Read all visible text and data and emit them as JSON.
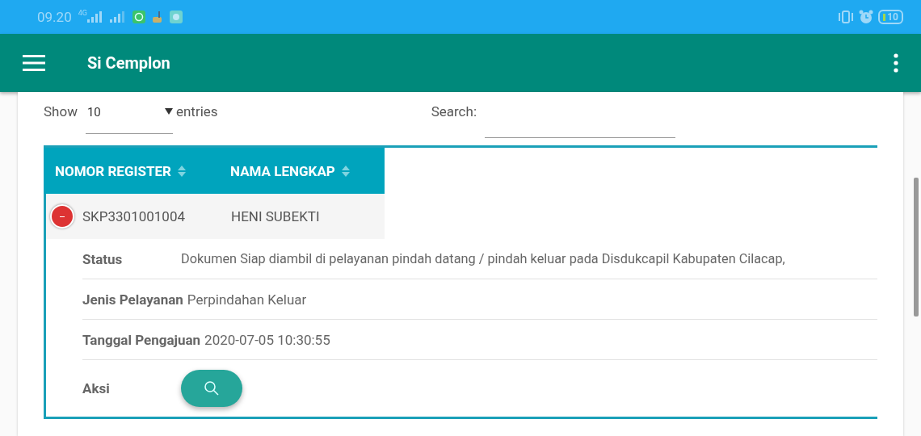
{
  "status_bar": {
    "time": "09.20",
    "network": "4G",
    "battery": "10"
  },
  "app_bar": {
    "title": "Si Cemplon"
  },
  "length_control": {
    "label_before": "Show",
    "value": "10",
    "label_after": "entries"
  },
  "search": {
    "label": "Search:"
  },
  "table": {
    "columns": [
      {
        "label": "NOMOR REGISTER"
      },
      {
        "label": "NAMA LENGKAP"
      }
    ],
    "rows": [
      {
        "expanded": true,
        "cells": [
          "SKP3301001004",
          "HENI SUBEKTI"
        ],
        "details": [
          {
            "kind": "text",
            "label": "Status",
            "value": "Dokumen Siap diambil di pelayanan pindah datang / pindah keluar pada Disdukcapil Kabupaten Cilacap,"
          },
          {
            "kind": "text",
            "label": "Jenis Pelayanan",
            "value": "Perpindahan Keluar"
          },
          {
            "kind": "text",
            "label": "Tanggal Pengajuan",
            "value": "2020-07-05 10:30:55"
          },
          {
            "kind": "action",
            "label": "Aksi"
          }
        ]
      }
    ]
  }
}
